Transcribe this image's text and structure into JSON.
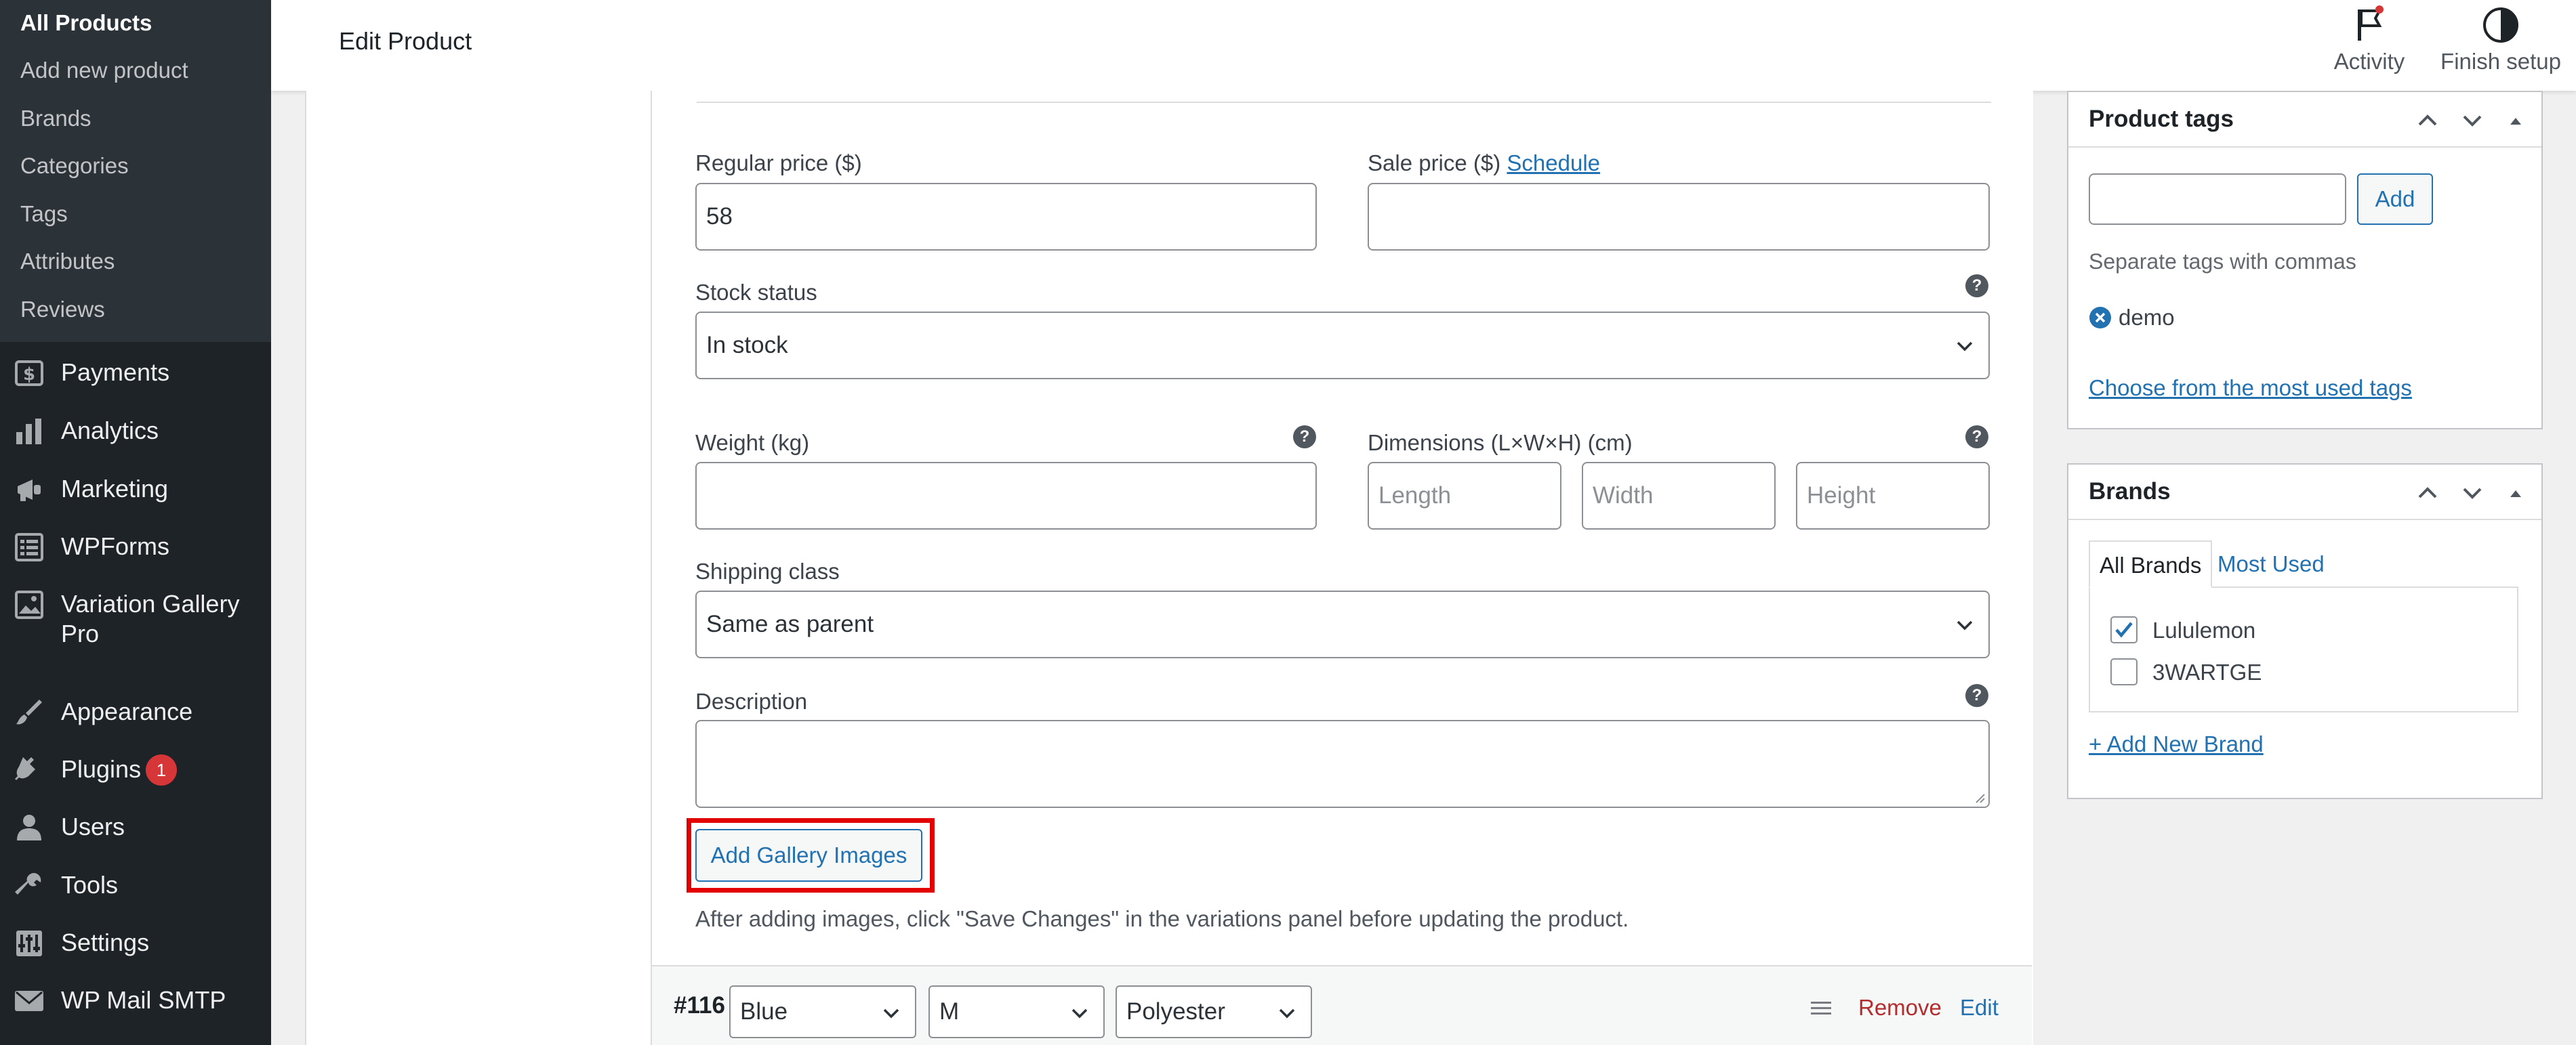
{
  "sidebar": {
    "submenu": [
      {
        "label": "All Products",
        "current": true
      },
      {
        "label": "Add new product"
      },
      {
        "label": "Brands"
      },
      {
        "label": "Categories"
      },
      {
        "label": "Tags"
      },
      {
        "label": "Attributes"
      },
      {
        "label": "Reviews"
      }
    ],
    "menu": [
      {
        "label": "Payments",
        "icon": "dollar-icon"
      },
      {
        "label": "Analytics",
        "icon": "bar-chart-icon"
      },
      {
        "label": "Marketing",
        "icon": "megaphone-icon"
      },
      {
        "label": "WPForms",
        "icon": "form-icon"
      },
      {
        "label": "Variation Gallery",
        "label2": "Pro",
        "icon": "gallery-icon"
      },
      {
        "label": "Appearance",
        "icon": "brush-icon"
      },
      {
        "label": "Plugins",
        "icon": "plug-icon",
        "badge": "1"
      },
      {
        "label": "Users",
        "icon": "user-icon"
      },
      {
        "label": "Tools",
        "icon": "wrench-icon"
      },
      {
        "label": "Settings",
        "icon": "sliders-icon"
      },
      {
        "label": "WP Mail SMTP",
        "icon": "mail-icon"
      }
    ]
  },
  "header": {
    "title": "Edit Product",
    "activity_label": "Activity",
    "finish_setup_label": "Finish setup"
  },
  "variation": {
    "regular_price_label": "Regular price ($)",
    "regular_price_value": "58",
    "sale_price_label": "Sale price ($)",
    "schedule_link": "Schedule",
    "stock_status_label": "Stock status",
    "stock_status_value": "In stock",
    "weight_label": "Weight (kg)",
    "dimensions_label": "Dimensions (L×W×H) (cm)",
    "length_placeholder": "Length",
    "width_placeholder": "Width",
    "height_placeholder": "Height",
    "shipping_class_label": "Shipping class",
    "shipping_class_value": "Same as parent",
    "description_label": "Description",
    "add_gallery_button": "Add Gallery Images",
    "gallery_note": "After adding images, click \"Save Changes\" in the variations panel before updating the product.",
    "next_variation": {
      "id": "#116",
      "color": "Blue",
      "size": "M",
      "material": "Polyester",
      "remove_label": "Remove",
      "edit_label": "Edit"
    }
  },
  "product_tags": {
    "title": "Product tags",
    "add_button": "Add",
    "hint": "Separate tags with commas",
    "tags": [
      "demo"
    ],
    "choose_link": "Choose from the most used tags"
  },
  "brands": {
    "title": "Brands",
    "tab_all": "All Brands",
    "tab_most_used": "Most Used",
    "items": [
      {
        "label": "Lululemon",
        "checked": true
      },
      {
        "label": "3WARTGE",
        "checked": false
      }
    ],
    "add_new_link": "+ Add New Brand"
  },
  "colors": {
    "sidebar_bg": "#1d2327",
    "submenu_bg": "#2c3338",
    "accent": "#2271b1",
    "danger": "#d63638",
    "highlight": "#e30000"
  }
}
